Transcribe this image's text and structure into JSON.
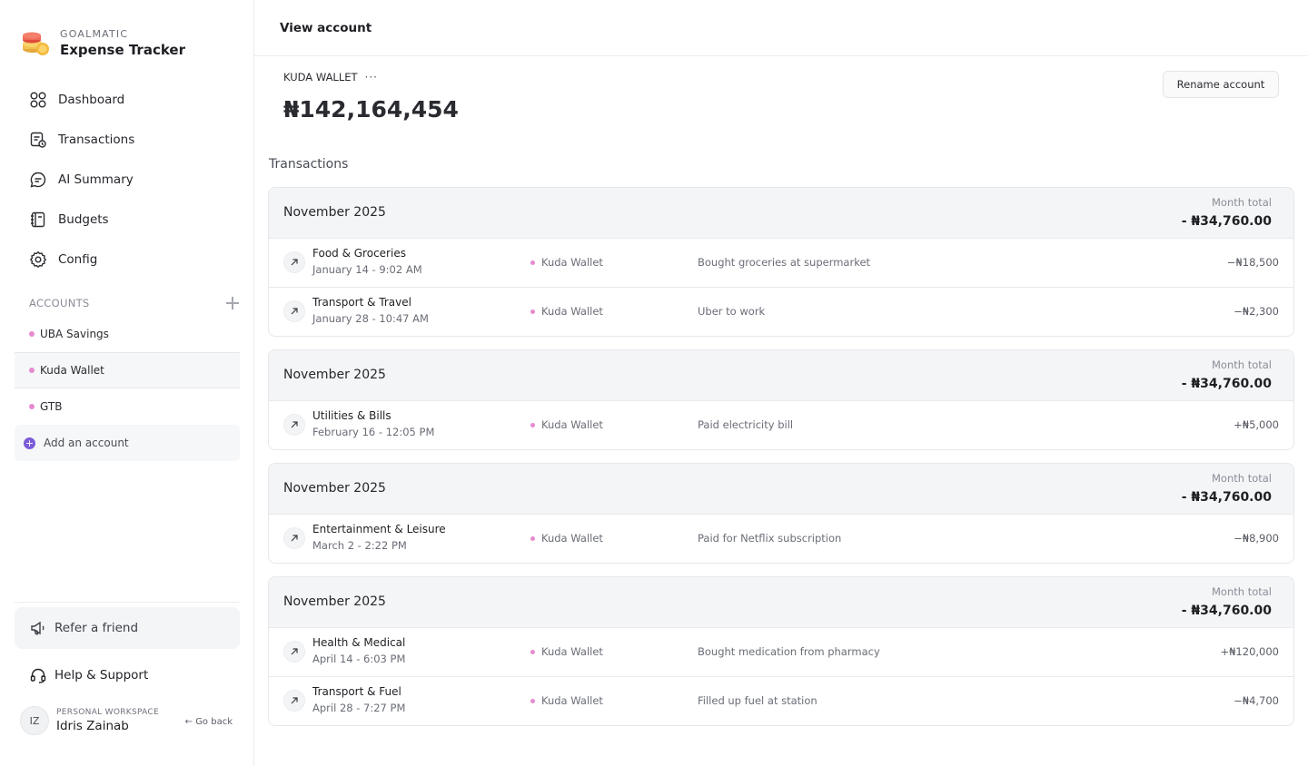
{
  "brand": {
    "tag": "GOALMATIC",
    "name": "Expense Tracker"
  },
  "nav": [
    {
      "label": "Dashboard",
      "icon": "grid-icon"
    },
    {
      "label": "Transactions",
      "icon": "transactions-icon"
    },
    {
      "label": "AI Summary",
      "icon": "chat-icon"
    },
    {
      "label": "Budgets",
      "icon": "notebook-icon"
    },
    {
      "label": "Config",
      "icon": "gear-icon"
    }
  ],
  "accounts": {
    "heading": "ACCOUNTS",
    "items": [
      {
        "label": "UBA Savings"
      },
      {
        "label": "Kuda Wallet"
      },
      {
        "label": "GTB"
      }
    ],
    "add_label": "Add an account",
    "dot_color": "#e68ad0"
  },
  "footer": {
    "refer_label": "Refer a friend",
    "help_label": "Help & Support",
    "workspace": "PERSONAL WORKSPACE",
    "user_name": "Idris Zainab",
    "user_initials": "IZ",
    "go_back": "Go back"
  },
  "header": {
    "title": "View account"
  },
  "wallet": {
    "name": "KUDA WALLET",
    "more": "···",
    "balance": "₦142,164,454",
    "rename_label": "Rename account"
  },
  "transactions": {
    "title": "Transactions",
    "month_total_label": "Month total",
    "groups": [
      {
        "month": "November 2025",
        "total": "- ₦34,760.00",
        "rows": [
          {
            "category": "Food & Groceries",
            "date": "January 14 - 9:02 AM",
            "account": "Kuda Wallet",
            "description": "Bought groceries at supermarket",
            "amount": "−₦18,500"
          },
          {
            "category": "Transport & Travel",
            "date": "January 28 - 10:47 AM",
            "account": "Kuda Wallet",
            "description": "Uber to work",
            "amount": "−₦2,300"
          }
        ]
      },
      {
        "month": "November 2025",
        "total": "- ₦34,760.00",
        "rows": [
          {
            "category": "Utilities & Bills",
            "date": "February 16 - 12:05 PM",
            "account": "Kuda Wallet",
            "description": "Paid electricity bill",
            "amount": "+₦5,000"
          }
        ]
      },
      {
        "month": "November 2025",
        "total": "- ₦34,760.00",
        "rows": [
          {
            "category": "Entertainment & Leisure",
            "date": "March 2 - 2:22 PM",
            "account": "Kuda Wallet",
            "description": "Paid for Netflix subscription",
            "amount": "−₦8,900"
          }
        ]
      },
      {
        "month": "November 2025",
        "total": "- ₦34,760.00",
        "rows": [
          {
            "category": "Health & Medical",
            "date": "April 14 - 6:03 PM",
            "account": "Kuda Wallet",
            "description": "Bought medication from pharmacy",
            "amount": "+₦120,000"
          },
          {
            "category": "Transport & Fuel",
            "date": "April 28 - 7:27 PM",
            "account": "Kuda Wallet",
            "description": "Filled up fuel at station",
            "amount": "−₦4,700"
          }
        ]
      }
    ]
  }
}
